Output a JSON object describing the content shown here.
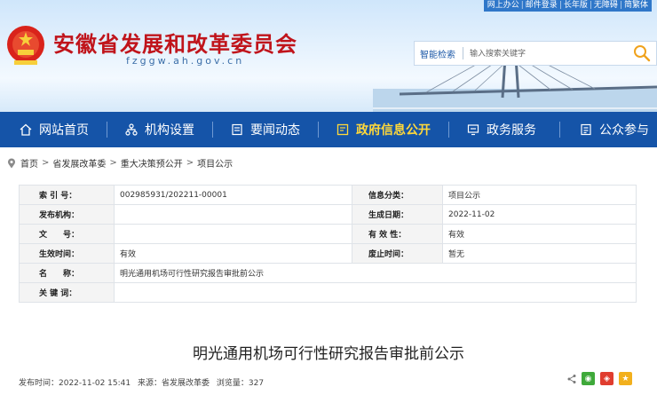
{
  "top_links": [
    "网上办公",
    "邮件登录",
    "长年版",
    "无障碍",
    "简繁体"
  ],
  "site": {
    "title": "安徽省发展和改革委员会",
    "domain": "fzggw.ah.gov.cn"
  },
  "search": {
    "label": "智能检索",
    "placeholder": "输入搜索关键字"
  },
  "nav": {
    "items": [
      {
        "label": "网站首页",
        "icon": "home-icon"
      },
      {
        "label": "机构设置",
        "icon": "org-chart-icon"
      },
      {
        "label": "要闻动态",
        "icon": "news-icon"
      },
      {
        "label": "政府信息公开",
        "icon": "info-open-icon",
        "active": true
      },
      {
        "label": "政务服务",
        "icon": "service-icon"
      },
      {
        "label": "公众参与",
        "icon": "participation-icon"
      }
    ]
  },
  "breadcrumb": [
    "首页",
    "省发展改革委",
    "重大决策预公开",
    "项目公示"
  ],
  "info": {
    "index_label": "索 引 号：",
    "index_value": "002985931/202211-00001",
    "category_label": "信息分类：",
    "category_value": "项目公示",
    "publisher_label": "发布机构：",
    "publisher_value": "",
    "date_label": "生成日期：",
    "date_value": "2022-11-02",
    "docno_label": "文　　号：",
    "docno_value": "",
    "validity_label": "有 效 性：",
    "validity_value": "有效",
    "effective_label": "生效时间：",
    "effective_value": "有效",
    "expire_label": "废止时间：",
    "expire_value": "暂无",
    "name_label": "名　　称：",
    "name_value": "明光通用机场可行性研究报告审批前公示",
    "keywords_label": "关 键 词：",
    "keywords_value": ""
  },
  "article": {
    "title": "明光通用机场可行性研究报告审批前公示",
    "publish_time": "发布时间：2022-11-02 15:41",
    "source": "来源：省发展改革委",
    "views": "浏览量：327"
  },
  "colors": {
    "nav_bg": "#1554a8",
    "title_red": "#c0141b",
    "active_nav": "#ffd83a",
    "top_bar": "#2f77c9"
  }
}
